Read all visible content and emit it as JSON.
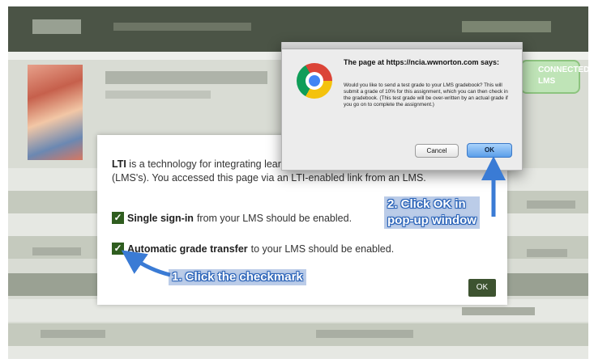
{
  "background": {
    "badge_label": "CONNECTED\nLMS"
  },
  "modal": {
    "intro_bold": "LTI",
    "intro_text": " is a technology for integrating learning tools with learning management systems (LMS's). You accessed this page via an LTI-enabled link from an LMS.",
    "item1_bold": "Single sign-in",
    "item1_text": "from your LMS should be enabled.",
    "item2_bold": "Automatic grade transfer",
    "item2_text": "to your LMS should be enabled.",
    "check_glyph": "✓",
    "ok_label": "OK"
  },
  "alert": {
    "heading": "The page at https://ncia.wwnorton.com says:",
    "message": "Would you like to send a test grade to your LMS gradebook? This will submit a grade of 10% for this assignment, which you can then check in the gradebook. (This test grade will be over-written by an actual grade if you go on to complete the assignment.)",
    "cancel_label": "Cancel",
    "ok_label": "OK",
    "icon": "chrome-icon"
  },
  "annotations": {
    "step1": "1. Click the checkmark",
    "step2_line1": "2. Click OK in",
    "step2_line2": "pop-up window",
    "arrow_color": "#3a7bd5"
  }
}
